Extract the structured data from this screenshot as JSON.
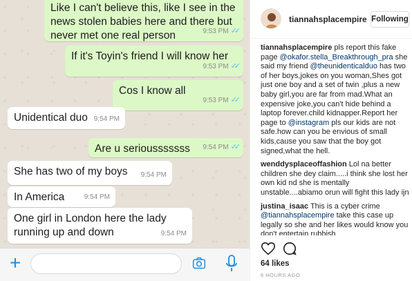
{
  "chat": {
    "messages": [
      {
        "dir": "out",
        "text": "Like I can't believe this, like I see in the news stolen babies here and there but never met one real person",
        "time": "9:53 PM"
      },
      {
        "dir": "out",
        "text": "If it's Toyin's friend I will know her",
        "time": "9:53 PM"
      },
      {
        "dir": "out",
        "text": "Cos I know all",
        "time": "9:53 PM"
      },
      {
        "dir": "in",
        "text": "Unidentical  duo",
        "time": "9:54 PM"
      },
      {
        "dir": "out",
        "text": "Are u seriousssssss",
        "time": "9:54 PM"
      },
      {
        "dir": "in",
        "text": "She has two of my boys",
        "time": "9:54 PM"
      },
      {
        "dir": "in",
        "text": "In America",
        "time": "9:54 PM"
      },
      {
        "dir": "in",
        "text": "One girl in London here the lady running up and down",
        "time": "9:54 PM"
      }
    ],
    "ticks": "✓✓",
    "composer": {
      "plus": "+",
      "input_value": ""
    }
  },
  "post": {
    "handle": "tiannahsplacempire",
    "follow_label": "Following",
    "comments": [
      {
        "user": "tiannahsplacempire",
        "parts": [
          {
            "t": " pls report this fake page "
          },
          {
            "t": "@okafor.stella_Breakthrough_pra",
            "m": true
          },
          {
            "t": " she said my friend "
          },
          {
            "t": "@theunidenticalduo",
            "m": true
          },
          {
            "t": " has two of her boys,jokes on you woman,Shes got just one boy and a set of twin ,plus a new baby girl,you are far from mad.What an expensive joke,you can't hide behind a laptop forever.child kidnapper.Report her page to "
          },
          {
            "t": "@instagram",
            "m": true
          },
          {
            "t": " pls our kids are not safe.how can you be envious of small kids,cause you saw that the boy got signed,what the hell."
          }
        ]
      },
      {
        "user": "wenddysplaceoffashion",
        "parts": [
          {
            "t": " Lol na better children she dey claim.....i think she lost her own kid nd she is mentally unstable....abiamo orun will fight this lady ijn"
          }
        ]
      },
      {
        "user": "justina_isaac",
        "parts": [
          {
            "t": " This is a cyber crime "
          },
          {
            "t": "@tiannahsplacempire",
            "m": true
          },
          {
            "t": " take this case up legally so she and her likes would know you don't entertain rubbish"
          }
        ]
      }
    ],
    "likes": "64 likes",
    "time": "6 HOURS AGO"
  }
}
